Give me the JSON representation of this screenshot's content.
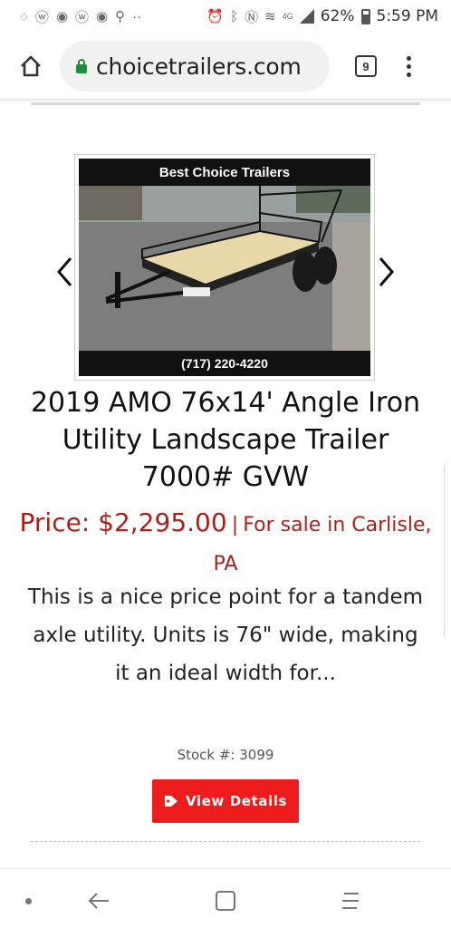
{
  "status_bar": {
    "battery": "62%",
    "time": "5:59 PM",
    "network": "4G"
  },
  "browser": {
    "url": "choicetrailers.com",
    "tab_count": "9"
  },
  "listing": {
    "image_banner_top": "Best Choice Trailers",
    "image_banner_bottom": "(717) 220-4220",
    "title": "2019 AMO 76x14' Angle Iron Utility Landscape Trailer 7000# GVW",
    "price": "Price: $2,295.00",
    "separator": "|",
    "sale_text": "For sale in Carlisle, PA",
    "description": "This is a nice price point for a tandem axle utility. Units is 76\" wide, making it an ideal width for...",
    "stock": "Stock #: 3099",
    "details_button": "View Details"
  },
  "colors": {
    "price_red": "#a8211d",
    "button_red": "#ee1c1c",
    "lock_green": "#1e8e3e"
  },
  "icons": [
    "home-icon",
    "lock-icon",
    "tabs-icon",
    "menu-icon",
    "chevron-left-icon",
    "chevron-right-icon",
    "tag-icon",
    "back-icon",
    "recents-icon",
    "home-nav-icon"
  ]
}
